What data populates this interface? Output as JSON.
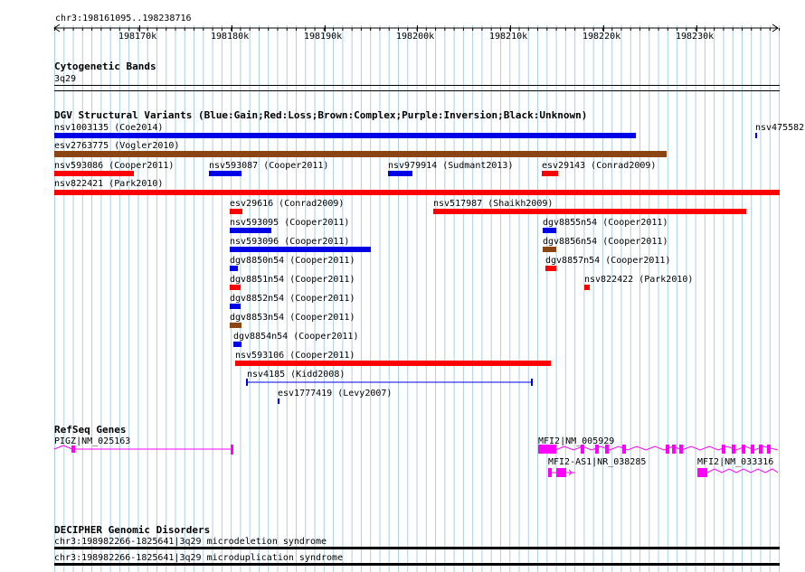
{
  "ruler": {
    "coordinate": "chr3:198161095..198238716",
    "labels": [
      "198170k",
      "198180k",
      "198190k",
      "198200k",
      "198210k",
      "198220k",
      "198230k"
    ]
  },
  "cytoband": {
    "title": "Cytogenetic Bands",
    "band": "3q29"
  },
  "dgv": {
    "title": "DGV Structural Variants (Blue:Gain;Red:Loss;Brown:Complex;Purple:Inversion;Black:Unknown)",
    "features": [
      {
        "label": "nsv1003135 (Coe2014)",
        "type": "gain"
      },
      {
        "label": "nsv475582",
        "type": "gain"
      },
      {
        "label": "esv2763775 (Vogler2010)",
        "type": "complex"
      },
      {
        "label": "nsv593086 (Cooper2011)",
        "type": "loss"
      },
      {
        "label": "nsv593087 (Cooper2011)",
        "type": "gain"
      },
      {
        "label": "nsv979914 (Sudmant2013)",
        "type": "gain"
      },
      {
        "label": "esv29143 (Conrad2009)",
        "type": "loss"
      },
      {
        "label": "nsv822421 (Park2010)",
        "type": "loss"
      },
      {
        "label": "esv29616 (Conrad2009)",
        "type": "loss"
      },
      {
        "label": "nsv517987 (Shaikh2009)",
        "type": "loss"
      },
      {
        "label": "nsv593095 (Cooper2011)",
        "type": "gain"
      },
      {
        "label": "dgv8855n54 (Cooper2011)",
        "type": "gain"
      },
      {
        "label": "nsv593096 (Cooper2011)",
        "type": "gain"
      },
      {
        "label": "dgv8856n54 (Cooper2011)",
        "type": "complex"
      },
      {
        "label": "dgv8850n54 (Cooper2011)",
        "type": "gain"
      },
      {
        "label": "dgv8857n54 (Cooper2011)",
        "type": "loss"
      },
      {
        "label": "dgv8851n54 (Cooper2011)",
        "type": "loss"
      },
      {
        "label": "nsv822422 (Park2010)",
        "type": "loss"
      },
      {
        "label": "dgv8852n54 (Cooper2011)",
        "type": "gain"
      },
      {
        "label": "dgv8853n54 (Cooper2011)",
        "type": "complex"
      },
      {
        "label": "dgv8854n54 (Cooper2011)",
        "type": "gain"
      },
      {
        "label": "nsv593106 (Cooper2011)",
        "type": "loss"
      },
      {
        "label": "nsv4185 (Kidd2008)",
        "type": "gain"
      },
      {
        "label": "esv1777419 (Levy2007)",
        "type": "gain"
      }
    ]
  },
  "refseq": {
    "title": "RefSeq Genes",
    "genes": [
      {
        "label": "PIGZ|NM_025163"
      },
      {
        "label": "MFI2|NM_005929"
      },
      {
        "label": "MFI2-AS1|NR_038285"
      },
      {
        "label": "MFI2|NM_033316"
      }
    ]
  },
  "decipher": {
    "title": "DECIPHER Genomic Disorders",
    "items": [
      {
        "label": "chr3:198982266-1825641|3q29 microdeletion syndrome"
      },
      {
        "label": "chr3:198982266-1825641|3q29 microduplication syndrome"
      }
    ]
  },
  "colors": {
    "gain": "#0000e6",
    "loss": "#ff0000",
    "complex": "#8b4513",
    "gene": "#ff00ff",
    "grid": "#a9d1e5",
    "line": "#000000"
  }
}
